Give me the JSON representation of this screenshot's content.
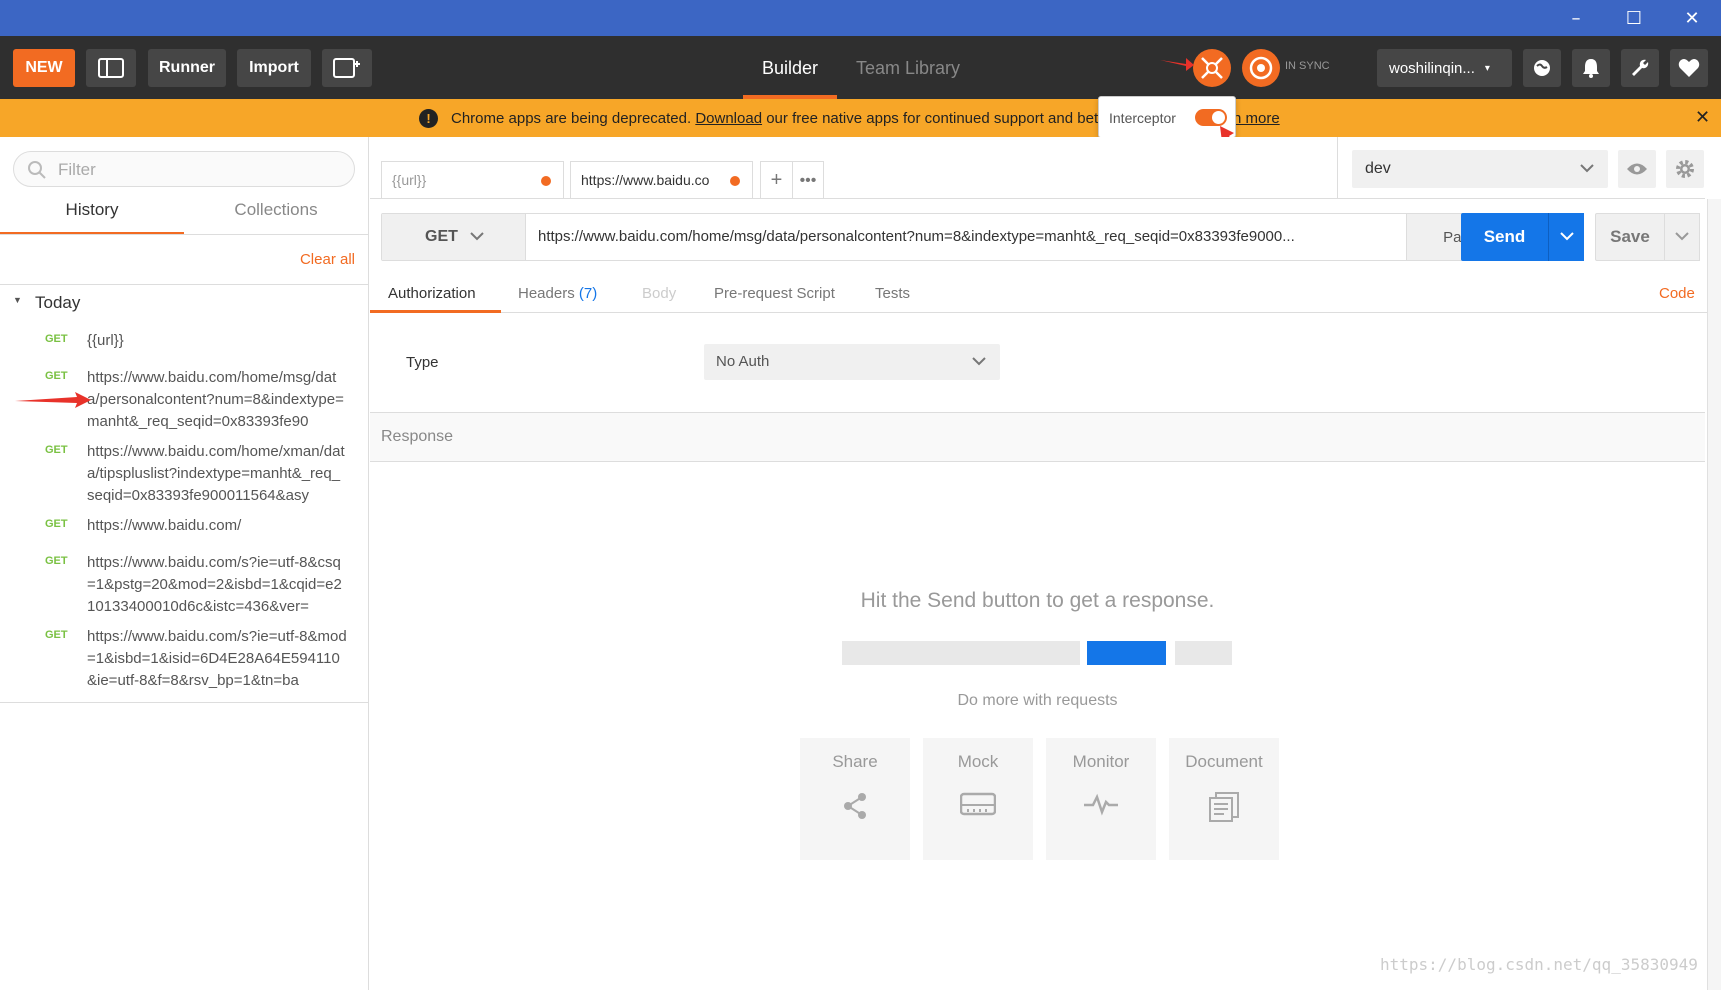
{
  "toolbar": {
    "new_label": "NEW",
    "runner_label": "Runner",
    "import_label": "Import",
    "tab_builder": "Builder",
    "tab_team_library": "Team Library",
    "sync_status": "IN SYNC",
    "user_name": "woshilinqin..."
  },
  "banner": {
    "text_before": "Chrome apps are being deprecated.",
    "link_download": "Download",
    "text_after": "our free native apps for continued support and bett",
    "link_more": "n more"
  },
  "interceptor": {
    "label": "Interceptor",
    "enabled": true
  },
  "sidebar": {
    "filter_placeholder": "Filter",
    "tab_history": "History",
    "tab_collections": "Collections",
    "clear_all": "Clear all",
    "group_today": "Today",
    "items": [
      {
        "method": "GET",
        "url": "{{url}}"
      },
      {
        "method": "GET",
        "url": "https://www.baidu.com/home/msg/data/personalcontent?num=8&indextype=manht&_req_seqid=0x83393fe90"
      },
      {
        "method": "GET",
        "url": "https://www.baidu.com/home/xman/data/tipspluslist?indextype=manht&_req_seqid=0x83393fe900011564&asy"
      },
      {
        "method": "GET",
        "url": "https://www.baidu.com/"
      },
      {
        "method": "GET",
        "url": "https://www.baidu.com/s?ie=utf-8&csq=1&pstg=20&mod=2&isbd=1&cqid=e210133400010d6c&istc=436&ver="
      },
      {
        "method": "GET",
        "url": "https://www.baidu.com/s?ie=utf-8&mod=1&isbd=1&isid=6D4E28A64E594110&ie=utf-8&f=8&rsv_bp=1&tn=ba"
      }
    ]
  },
  "request_tabs": [
    {
      "label": "{{url}}"
    },
    {
      "label": "https://www.baidu.co"
    }
  ],
  "environment": {
    "selected": "dev"
  },
  "request": {
    "method": "GET",
    "url": "https://www.baidu.com/home/msg/data/personalcontent?num=8&indextype=manht&_req_seqid=0x83393fe9000...",
    "params_label": "Params",
    "send_label": "Send",
    "save_label": "Save"
  },
  "request_subtabs": {
    "authorization": "Authorization",
    "headers": "Headers",
    "headers_count": "(7)",
    "body": "Body",
    "prerequest": "Pre-request Script",
    "tests": "Tests",
    "code": "Code"
  },
  "auth": {
    "type_label": "Type",
    "type_value": "No Auth"
  },
  "response": {
    "header": "Response",
    "empty_message": "Hit the Send button to get a response.",
    "more_title": "Do more with requests",
    "cards": [
      {
        "label": "Share",
        "icon": "share-icon"
      },
      {
        "label": "Mock",
        "icon": "mock-icon"
      },
      {
        "label": "Monitor",
        "icon": "monitor-icon"
      },
      {
        "label": "Document",
        "icon": "document-icon"
      }
    ]
  },
  "watermark": "https://blog.csdn.net/qq_35830949",
  "colors": {
    "accent_orange": "#f26b22",
    "send_blue": "#1476e8",
    "title_bar": "#3c66c4",
    "banner": "#f7a628",
    "method_green": "#7ac143"
  }
}
